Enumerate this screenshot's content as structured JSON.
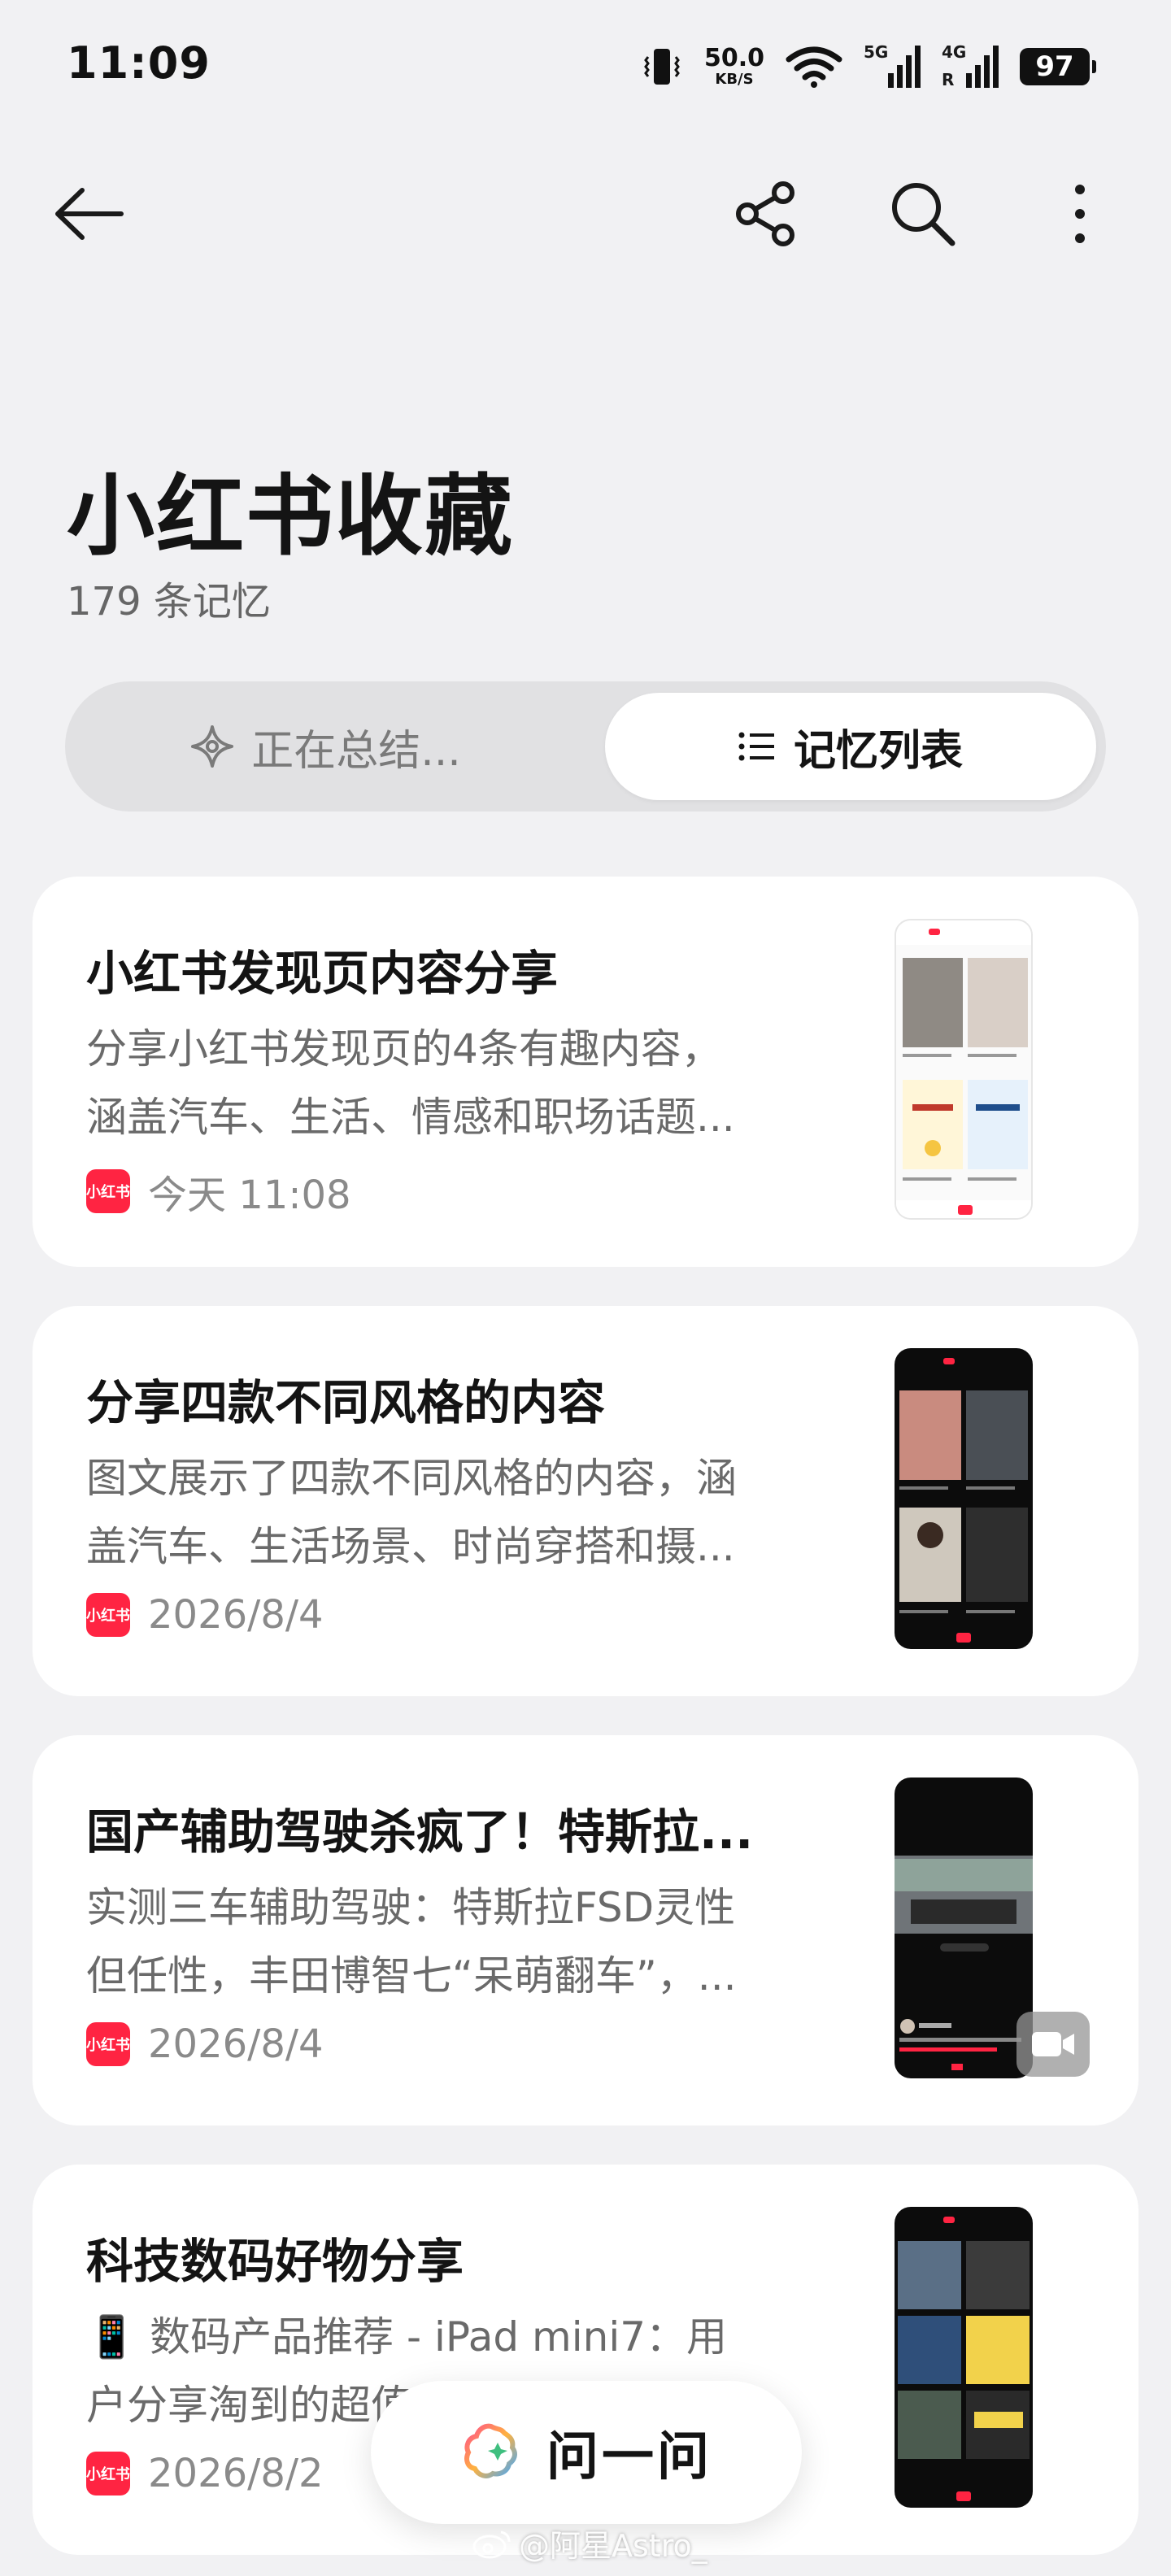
{
  "status_bar": {
    "time": "11:09",
    "net_speed": "50.0",
    "net_unit": "KB/S",
    "sig1_label": "5G",
    "sig2_label": "4G",
    "sig2_sub": "R",
    "battery": "97"
  },
  "header": {
    "title": "小红书收藏",
    "subtitle": "179 条记忆"
  },
  "tabs": {
    "left_label": "正在总结...",
    "right_label": "记忆列表"
  },
  "cards": [
    {
      "title": "小红书发现页内容分享",
      "desc_line1": "分享小红书发现页的4条有趣内容，",
      "desc_line2": "涵盖汽车、生活、情感和职场话题...",
      "source": "小红书",
      "date": "今天 11:08"
    },
    {
      "title": "分享四款不同风格的内容",
      "desc_line1": "图文展示了四款不同风格的内容，涵",
      "desc_line2": "盖汽车、生活场景、时尚穿搭和摄...",
      "source": "小红书",
      "date": "2026/8/4"
    },
    {
      "title": "国产辅助驾驶杀疯了！特斯拉...",
      "desc_line1": "实测三车辅助驾驶：特斯拉FSD灵性",
      "desc_line2": "但任性，丰田博智七“呆萌翻车”，...",
      "source": "小红书",
      "date": "2026/8/4"
    },
    {
      "title": "科技数码好物分享",
      "desc_line1": "📱 数码产品推荐 - iPad mini7：用",
      "desc_line2": "户分享淘到的超值...",
      "source": "小红书",
      "date": "2026/8/2"
    }
  ],
  "ask_button": {
    "label": "问一问"
  },
  "watermark": "@阿星Astro_",
  "colors": {
    "brand_red": "#ff2442",
    "background": "#f1f1f3",
    "card": "#ffffff"
  },
  "icons": [
    "back-arrow-icon",
    "share-icon",
    "search-icon",
    "more-vertical-icon",
    "sparkle-icon",
    "list-icon",
    "video-icon",
    "ai-assistant-icon",
    "weibo-icon"
  ]
}
